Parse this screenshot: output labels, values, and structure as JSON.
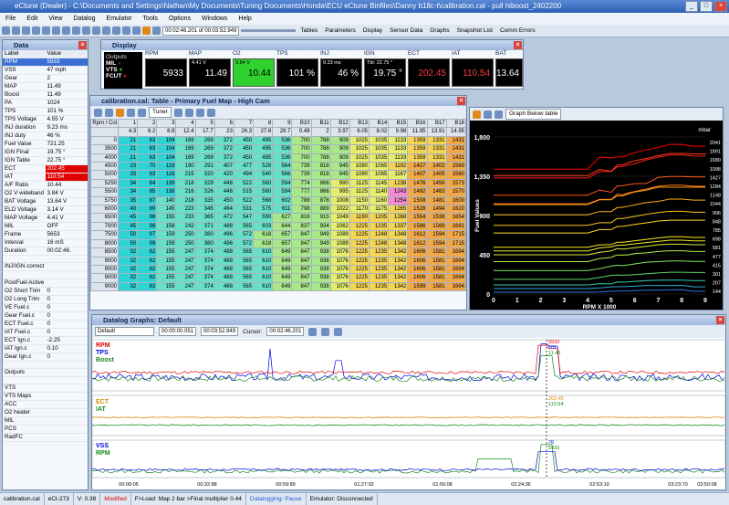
{
  "app": {
    "title": "eCtune (Dealer) - C:\\Documents and Settings\\Nathan\\My Documents\\Tuning Documents\\Honda\\ECU eCtune  Binfiles\\Danny b18c-t\\calibration.cal - pull hiboost_2402200"
  },
  "menu": [
    "File",
    "Edit",
    "View",
    "Datalog",
    "Emulator",
    "Tools",
    "Options",
    "Windows",
    "Help"
  ],
  "toolbar": {
    "time": "00:02:46.201 of 00:03:52.949",
    "tables": "Tables",
    "parameters": "Parameters",
    "display": "Display",
    "sensor_data": "Sensor Data",
    "graphs": "Graphs",
    "snapshot": "Snapshot List",
    "comm_errors": "Comm Errors"
  },
  "data_panel": {
    "title": "Data",
    "col1": "Label",
    "col2": "Value",
    "rows": [
      [
        "RPM",
        "5933"
      ],
      [
        "VSS",
        "47 mph"
      ],
      [
        "Gear",
        "2"
      ],
      [
        "MAP",
        "11.49"
      ],
      [
        "Boost",
        "11.49"
      ],
      [
        "PA",
        "1024"
      ],
      [
        "TPS",
        "101 %"
      ],
      [
        "TPS Voltage",
        "4.55 V"
      ],
      [
        "INJ duration",
        "9.23 ms"
      ],
      [
        "INJ duty",
        "46 %"
      ],
      [
        "Fuel Value",
        "721.25"
      ],
      [
        "IGN Final",
        "19.75 °"
      ],
      [
        "IGN Table",
        "22.75 °"
      ],
      [
        "ECT",
        "202.45"
      ],
      [
        "IAT",
        "110.54"
      ],
      [
        "A/F Ratio",
        "10.44"
      ],
      [
        "O2 V wideband",
        "3.84 V"
      ],
      [
        "BAT Voltage",
        "13.64 V"
      ],
      [
        "ELD Voltage",
        "3.14 V"
      ],
      [
        "MAP Voltage",
        "4.41 V"
      ],
      [
        "MIL",
        "OFF"
      ],
      [
        "Frame",
        "5653"
      ],
      [
        "Interval",
        "16 mS"
      ],
      [
        "Duration",
        "00:02:46."
      ],
      [
        "",
        ""
      ],
      [
        "INJ/IGN correct",
        ""
      ],
      [
        "",
        ""
      ],
      [
        "PostFuel Active",
        ""
      ],
      [
        "O2 Short Trim",
        "0"
      ],
      [
        "O2 Long Trim",
        "0"
      ],
      [
        "VE Fuel.c",
        "0"
      ],
      [
        "Gear Fuel.c",
        "0"
      ],
      [
        "ECT Fuel.c",
        "0"
      ],
      [
        "IAT Fuel.c",
        "0"
      ],
      [
        "ECT Ign.c",
        "-2.25"
      ],
      [
        "IAT Ign.c",
        "0.10"
      ],
      [
        "Gear Ign.c",
        "0"
      ],
      [
        "",
        ""
      ],
      [
        "Outputs",
        ""
      ],
      [
        "",
        ""
      ],
      [
        "VTS",
        ""
      ],
      [
        "VTS Maps",
        ""
      ],
      [
        "ACC",
        ""
      ],
      [
        "O2 heater",
        ""
      ],
      [
        "MIL",
        ""
      ],
      [
        "PCS",
        ""
      ],
      [
        "RadFC",
        ""
      ]
    ]
  },
  "display": {
    "title": "Display",
    "outputs_label": "Outputs",
    "mil": "MIL",
    "vts": "VTS",
    "fcut": "FCUT",
    "gauges": [
      {
        "label": "RPM",
        "value": "5933",
        "sub": ""
      },
      {
        "label": "MAP",
        "value": "11.49",
        "sub": "4.41 V"
      },
      {
        "label": "O2",
        "value": "10.44",
        "sub": "3.84 V"
      },
      {
        "label": "TPS",
        "value": "101 %",
        "sub": ""
      },
      {
        "label": "INJ",
        "value": "46 %",
        "sub": "9.23 ms"
      },
      {
        "label": "IGN",
        "value": "19.75 °",
        "sub": "Tbl: 22.75 °"
      },
      {
        "label": "ECT",
        "value": "202.45",
        "sub": ""
      },
      {
        "label": "IAT",
        "value": "110.54",
        "sub": ""
      },
      {
        "label": "BAT",
        "value": "13.64",
        "sub": ""
      }
    ]
  },
  "fuelmap": {
    "title": "calibration.cal: Table - Primary Fuel Map - High Cam",
    "corner": "Rpm / Col",
    "tuner": "Tuner",
    "col_nums": [
      "1",
      "2",
      "3",
      "4",
      "5",
      "6",
      "7",
      "8",
      "9",
      "B10",
      "B11",
      "B12",
      "B13",
      "B14",
      "B15",
      "B16",
      "B17",
      "B18"
    ],
    "mmhg": [
      "4.3",
      "6.2",
      "8.8",
      "12.4",
      "17.7",
      "23",
      "26.3",
      "27.8",
      "29.7",
      "0.49",
      "2",
      "3.97",
      "6.05",
      "8.02",
      "9.98",
      "11.95",
      "13.91",
      "14.95"
    ],
    "rpms": [
      "0",
      "3500",
      "4000",
      "4500",
      "5000",
      "5250",
      "5500",
      "5750",
      "6000",
      "6500",
      "7000",
      "7500",
      "8000",
      "8500",
      "9000",
      "9000",
      "9000",
      "9000"
    ],
    "rows": [
      [
        21,
        63,
        104,
        169,
        269,
        372,
        450,
        495,
        536,
        700,
        788,
        909,
        1025,
        1035,
        1133,
        1359,
        1331,
        1431
      ],
      [
        21,
        63,
        104,
        169,
        269,
        372,
        450,
        495,
        536,
        700,
        788,
        909,
        1025,
        1035,
        1133,
        1359,
        1331,
        1431
      ],
      [
        21,
        63,
        104,
        169,
        269,
        372,
        450,
        495,
        536,
        700,
        788,
        909,
        1025,
        1035,
        1133,
        1359,
        1331,
        1431
      ],
      [
        23,
        70,
        119,
        190,
        291,
        407,
        477,
        528,
        564,
        739,
        818,
        945,
        1080,
        1085,
        1192,
        1427,
        1402,
        1569
      ],
      [
        33,
        83,
        116,
        215,
        320,
        420,
        494,
        540,
        566,
        739,
        818,
        945,
        1080,
        1085,
        1167,
        1407,
        1405,
        1560
      ],
      [
        34,
        84,
        139,
        218,
        329,
        448,
        522,
        560,
        594,
        774,
        866,
        990,
        1125,
        1145,
        1238,
        1476,
        1456,
        1573
      ],
      [
        34,
        85,
        138,
        216,
        326,
        446,
        515,
        560,
        594,
        777,
        866,
        995,
        1125,
        1140,
        1243,
        1482,
        1463,
        1570
      ],
      [
        35,
        87,
        140,
        218,
        335,
        450,
        522,
        568,
        602,
        788,
        878,
        1008,
        1150,
        1160,
        1254,
        1508,
        1481,
        1600
      ],
      [
        40,
        90,
        145,
        223,
        345,
        464,
        531,
        575,
        611,
        798,
        889,
        1022,
        1170,
        1175,
        1265,
        1528,
        1494,
        1620
      ],
      [
        45,
        98,
        155,
        233,
        365,
        472,
        547,
        590,
        627,
        816,
        915,
        1049,
        1190,
        1205,
        1268,
        1554,
        1538,
        1654
      ],
      [
        45,
        98,
        158,
        242,
        371,
        488,
        565,
        603,
        644,
        837,
        934,
        1062,
        1225,
        1235,
        1337,
        1586,
        1569,
        1681
      ],
      [
        50,
        97,
        159,
        250,
        380,
        496,
        572,
        618,
        657,
        847,
        949,
        1089,
        1225,
        1248,
        1348,
        1612,
        1594,
        1715
      ],
      [
        50,
        99,
        159,
        250,
        380,
        496,
        572,
        618,
        657,
        847,
        949,
        1089,
        1225,
        1248,
        1348,
        1612,
        1594,
        1715
      ],
      [
        32,
        82,
        155,
        247,
        374,
        488,
        565,
        610,
        649,
        847,
        938,
        1076,
        1225,
        1235,
        1342,
        1606,
        1581,
        1694
      ],
      [
        32,
        82,
        155,
        247,
        374,
        488,
        565,
        610,
        649,
        847,
        938,
        1076,
        1225,
        1235,
        1342,
        1606,
        1581,
        1694
      ],
      [
        32,
        82,
        155,
        247,
        374,
        488,
        565,
        610,
        649,
        847,
        938,
        1076,
        1225,
        1235,
        1342,
        1606,
        1581,
        1694
      ],
      [
        32,
        82,
        155,
        247,
        374,
        488,
        565,
        610,
        649,
        847,
        938,
        1076,
        1225,
        1235,
        1342,
        1606,
        1581,
        1694
      ],
      [
        32,
        82,
        155,
        247,
        374,
        488,
        565,
        610,
        649,
        847,
        938,
        1076,
        1225,
        1235,
        1342,
        1599,
        1581,
        1694
      ]
    ]
  },
  "graph3d": {
    "btn": "Graph Below table",
    "ylabel": "Fuel Values",
    "xlabel": "RPM X 1000",
    "unit": "mbar",
    "yticks": [
      "1,800",
      "1,350",
      "900",
      "450",
      "0"
    ],
    "xticks": [
      "0",
      "1",
      "2",
      "3",
      "4",
      "5",
      "6",
      "7",
      "8",
      "9"
    ],
    "right_labels": [
      "2041",
      "1891",
      "1680",
      "1098",
      "1427",
      "1284",
      "1148",
      "1044",
      "906",
      "848",
      "785",
      "698",
      "581",
      "477",
      "415",
      "301",
      "207",
      "144"
    ]
  },
  "datalog": {
    "title": "Datalog Graphs: Default",
    "preset": "Default",
    "start": "00:00:00.051",
    "end": "00:03:52.949",
    "cursor_label": "Cursor:",
    "cursor": "00:02:46.201",
    "g1": [
      "RPM",
      "TPS",
      "Boost"
    ],
    "g1vals": [
      "5933",
      "101",
      "11.49"
    ],
    "g2": [
      "ECT",
      "IAT"
    ],
    "g2vals": [
      "202.45",
      "110.54"
    ],
    "g3": [
      "VSS",
      "RPM"
    ],
    "g3vals": [
      "76",
      "5933"
    ],
    "times": [
      "00:00:05",
      "00:32:88",
      "00:59:89",
      "01:27:92",
      "01:56:08",
      "02:24:36",
      "02:53:10",
      "03:23:70",
      "03:50:08"
    ]
  },
  "status": [
    "calibration.cal",
    "eCt-273",
    "V: 0.38",
    "Modified",
    "F>Load: Map 2 bar >Final multiplier 0.44",
    "Datalogging: Pause",
    "Emulator: Disconnected"
  ],
  "colors": {
    "red": "#e10000",
    "blue": "#0000e6",
    "green": "#1a8a1a",
    "orange": "#d38a00"
  }
}
